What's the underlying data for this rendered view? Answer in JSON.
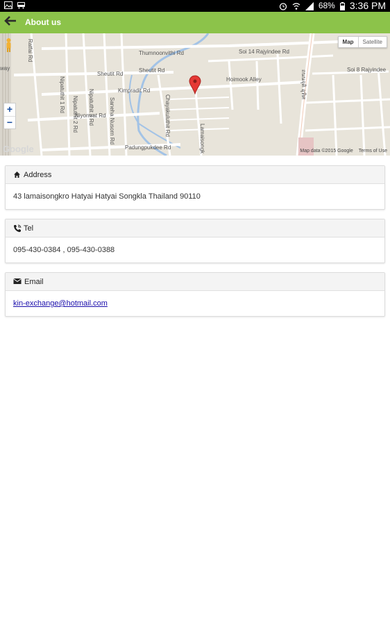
{
  "status_bar": {
    "battery": "68%",
    "time": "3:36 PM"
  },
  "app_bar": {
    "title": "About us"
  },
  "map": {
    "streets": {
      "thumnoonvithi": "Thumnoonvithi Rd",
      "soi14": "Soi 14 Rajyindee Rd",
      "sheutit": "Sheutit Rd",
      "sheutit2": "Sheutit Rd",
      "hoimook": "Hoimook Alley",
      "soi8": "Soi 8 Rajyindee",
      "kimpradit": "Kimpradit Rd",
      "nipatuthit1": "Nipatuthit 1 Rd",
      "nipatuthit2": "Nipatuthit 2 Rd",
      "nipatuthit3": "Nipatuthit 3 Rd",
      "sanehanusorn": "Saneha Nusorn Rd",
      "chayakulnit": "Chayakuluthit Rd",
      "lamaisongkro": "Lamaisongk",
      "niyomrat": "Niyomrat Rd",
      "padungpukdee": "Padungpukdee Rd",
      "ratfai": "Ratfai Rd",
      "thai": "ถนนจุติ อุทิศ",
      "way": "way"
    },
    "type_control": {
      "map": "Map",
      "satellite": "Satellite"
    },
    "zoom_in": "+",
    "zoom_out": "−",
    "google": "Google",
    "attribution": "Map data ©2015 Google",
    "terms": "Terms of Use"
  },
  "cards": {
    "address": {
      "label": "Address",
      "value": "43 lamaisongkro Hatyai Hatyai Songkla Thailand 90110"
    },
    "tel": {
      "label": "Tel",
      "value": "095-430-0384 , 095-430-0388"
    },
    "email": {
      "label": "Email",
      "value": "kin-exchange@hotmail.com"
    }
  },
  "colors": {
    "app_bar": "#8cc34a",
    "status_bar": "#000000",
    "map_bg": "#e8e4da",
    "marker": "#e53935"
  }
}
